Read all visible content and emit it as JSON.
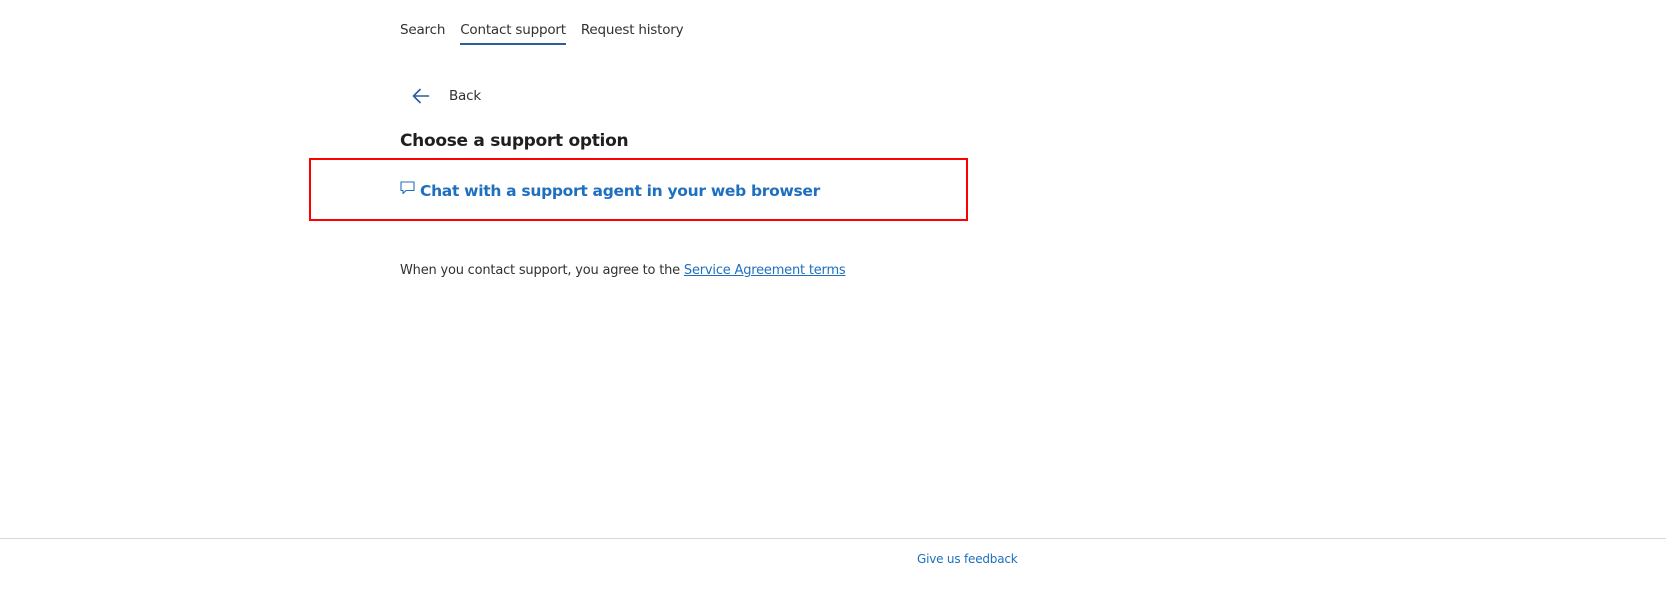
{
  "tabs": [
    {
      "label": "Search",
      "active": false
    },
    {
      "label": "Contact support",
      "active": true
    },
    {
      "label": "Request history",
      "active": false
    }
  ],
  "back": {
    "label": "Back",
    "icon": "arrow-left-icon"
  },
  "heading": "Choose a support option",
  "options": [
    {
      "label": "Chat with a support agent in your web browser",
      "icon": "chat-bubble-icon"
    }
  ],
  "agreement": {
    "text": "When you contact support, you agree to the ",
    "link_label": "Service Agreement terms"
  },
  "footer": {
    "feedback_label": "Give us feedback"
  },
  "colors": {
    "accent": "#1f6fbf",
    "tab_underline": "#2c5e9e",
    "highlight": "#ff0000"
  }
}
